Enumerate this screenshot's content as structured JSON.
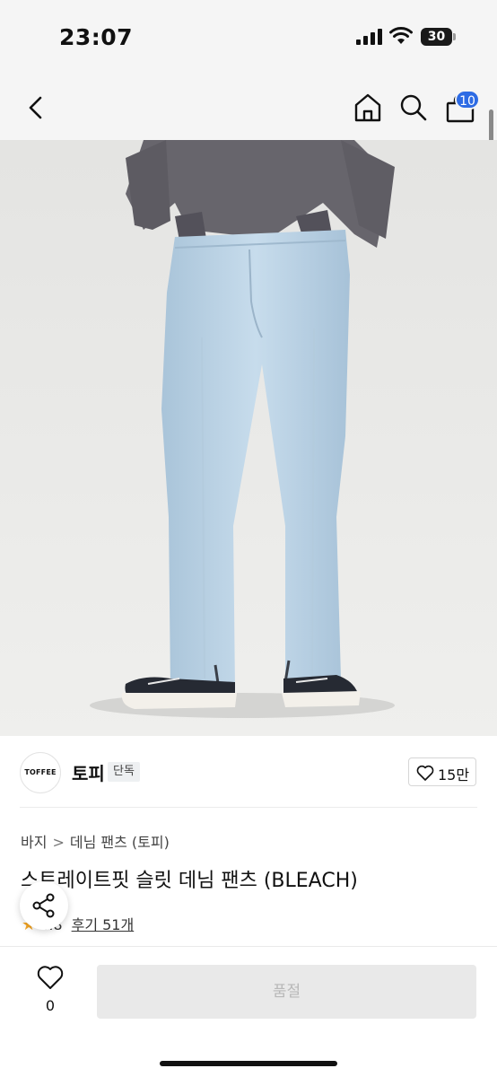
{
  "status_bar": {
    "time": "23:07",
    "battery_level": "30"
  },
  "header": {
    "back_icon": "chevron-left-icon",
    "home_icon": "home-icon",
    "search_icon": "search-icon",
    "cart_icon": "shopping-bag-icon",
    "cart_count": "10",
    "badge_color": "#2d6be4"
  },
  "product_image": {
    "shirt_color": "#66646b",
    "jeans_color": "#b9d3e6",
    "background": "#e6e6e4"
  },
  "brand": {
    "logo_text": "TOFFEE",
    "name": "토피",
    "tag": "단독",
    "likes": "15만"
  },
  "product": {
    "breadcrumb": [
      "바지",
      "데님 팬츠 (토피)"
    ],
    "title": "스트레이트핏 슬릿 데님 팬츠 (BLEACH)",
    "rating": "4.8",
    "reviews": "후기 51개"
  },
  "bottom_bar": {
    "wish_count": "0",
    "soldout_label": "품절"
  }
}
